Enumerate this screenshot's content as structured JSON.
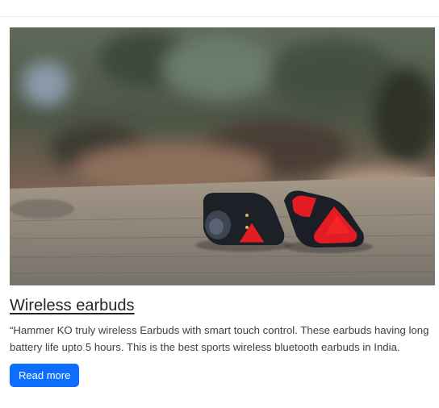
{
  "card": {
    "image_alt_icon": "earbuds-photo",
    "title": "Wireless earbuds",
    "description": "“Hammer KO truly wireless Earbuds with smart touch control. These earbuds having long battery life upto 5 hours. This is the best sports wireless bluetooth earbuds in India.",
    "button_label": "Read more"
  },
  "colors": {
    "accent": "#0d6efd",
    "earbud_red": "#e31b23",
    "earbud_body": "#1b1e24"
  }
}
